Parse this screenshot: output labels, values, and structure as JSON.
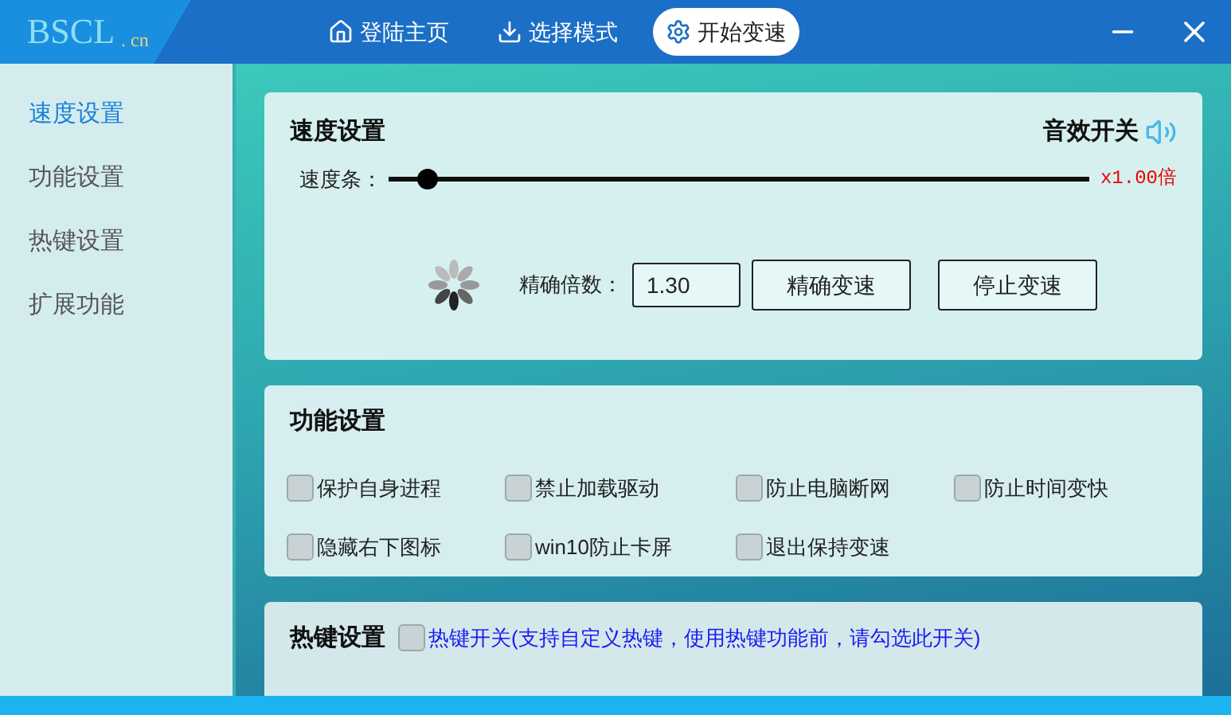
{
  "header": {
    "logo_main": "BSCL",
    "logo_suffix": ". cn",
    "nav": [
      {
        "label": "登陆主页",
        "selected": false
      },
      {
        "label": "选择模式",
        "selected": false
      },
      {
        "label": "开始变速",
        "selected": true
      }
    ]
  },
  "sidebar": {
    "items": [
      {
        "label": "速度设置",
        "selected": true
      },
      {
        "label": "功能设置",
        "selected": false
      },
      {
        "label": "热键设置",
        "selected": false
      },
      {
        "label": "扩展功能",
        "selected": false
      }
    ]
  },
  "speed": {
    "title": "速度设置",
    "sound_label": "音效开关",
    "slider_label": "速度条：",
    "level": 0.04,
    "reading": "x1.00倍",
    "precise_label": "精确倍数：",
    "precise_value": "1.30",
    "buttons": [
      "精确变速",
      "停止变速"
    ]
  },
  "features": {
    "title": "功能设置",
    "options": [
      {
        "label": "保护自身进程",
        "checked": false
      },
      {
        "label": "禁止加载驱动",
        "checked": false
      },
      {
        "label": "防止电脑断网",
        "checked": false
      },
      {
        "label": "防止时间变快",
        "checked": false
      },
      {
        "label": "隐藏右下图标",
        "checked": false
      },
      {
        "label": "win10防止卡屏",
        "checked": false
      },
      {
        "label": "退出保持变速",
        "checked": false
      }
    ]
  },
  "hotkeys": {
    "title": "热键设置",
    "toggle": {
      "label": "热键开关(支持自定义热键，使用热键功能前，请勾选此开关)",
      "checked": false
    }
  }
}
